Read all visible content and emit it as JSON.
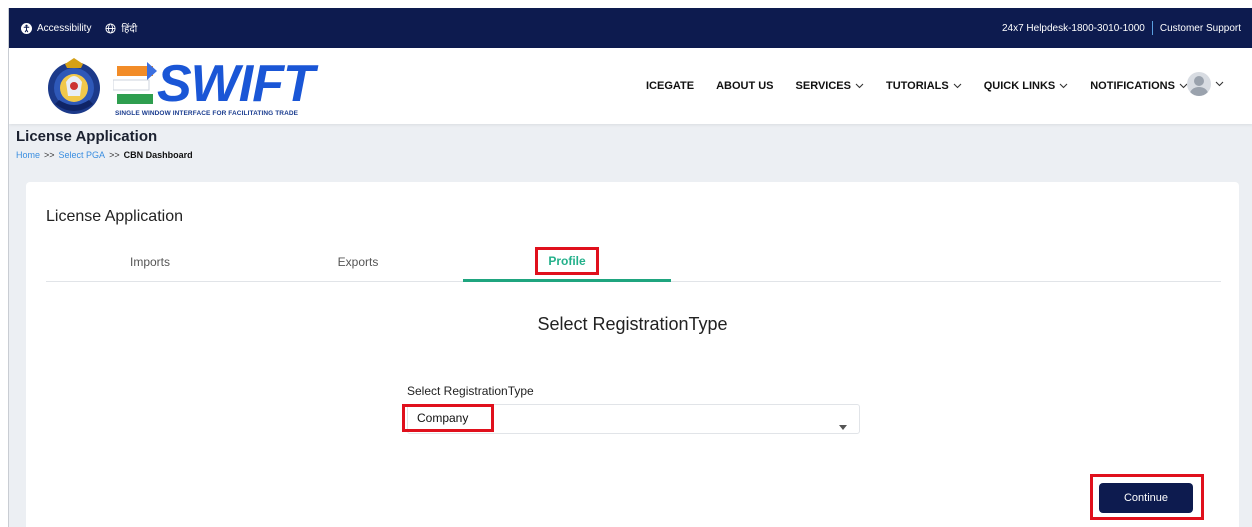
{
  "topbar": {
    "accessibility": "Accessibility",
    "language": "हिंदी",
    "helpdesk": "24x7 Helpdesk-1800-3010-1000",
    "support": "Customer Support"
  },
  "brand": {
    "name": "SWIFT",
    "tagline": "SINGLE WINDOW INTERFACE FOR FACILITATING TRADE",
    "accent_blue": "#1a56d6",
    "navy": "#0d1b4f"
  },
  "nav": {
    "items": [
      {
        "label": "ICEGATE",
        "dropdown": false
      },
      {
        "label": "ABOUT US",
        "dropdown": false
      },
      {
        "label": "SERVICES",
        "dropdown": true
      },
      {
        "label": "TUTORIALS",
        "dropdown": true
      },
      {
        "label": "QUICK LINKS",
        "dropdown": true
      },
      {
        "label": "NOTIFICATIONS",
        "dropdown": true
      }
    ]
  },
  "page": {
    "title": "License Application",
    "breadcrumb": {
      "home": "Home",
      "sep": ">>",
      "select_pga": "Select PGA",
      "current": "CBN Dashboard"
    }
  },
  "card": {
    "title": "License Application",
    "tabs": [
      {
        "label": "Imports",
        "active": false
      },
      {
        "label": "Exports",
        "active": false
      },
      {
        "label": "Profile",
        "active": true
      }
    ],
    "section_heading": "Select RegistrationType",
    "field_label": "Select RegistrationType",
    "select_value": "Company",
    "continue_label": "Continue"
  },
  "colors": {
    "active_tab": "#1fa57f",
    "highlight_box": "#e0101c"
  }
}
